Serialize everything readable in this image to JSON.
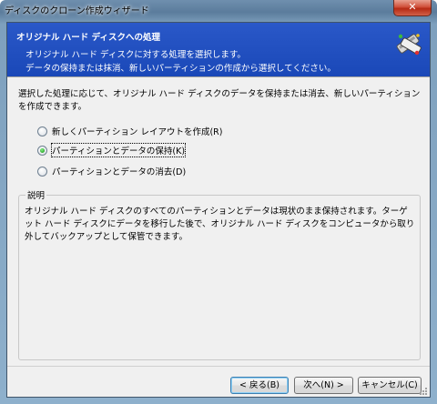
{
  "window": {
    "title": "ディスクのクローン作成ウィザード",
    "close_glyph": "✕"
  },
  "header": {
    "title": "オリジナル ハード ディスクへの処理",
    "desc_line1": "オリジナル ハード ディスクに対する処理を選択します。",
    "desc_line2": "データの保持または抹消、新しいパーティションの作成から選択してください。",
    "icon": "disk-clone-icon"
  },
  "intro_text": "選択した処理に応じて、オリジナル ハード ディスクのデータを保持または消去、新しいパーティションを作成できます。",
  "options": [
    {
      "label": "新しくパーティション レイアウトを作成(R)",
      "checked": false
    },
    {
      "label": "パーティションとデータの保持(K)",
      "checked": true
    },
    {
      "label": "パーティションとデータの消去(D)",
      "checked": false
    }
  ],
  "description_group": {
    "title": "説明",
    "text": "オリジナル ハード ディスクのすべてのパーティションとデータは現状のまま保持されます。ターゲット ハード ディスクにデータを移行した後で、オリジナル ハード ディスクをコンピュータから取り外してバックアップとして保管できます。"
  },
  "buttons": {
    "back": "< 戻る(B)",
    "next": "次へ(N) >",
    "cancel": "キャンセル(C)"
  },
  "colors": {
    "header_bg": "#1a48b8",
    "frame": "#7ea0bd",
    "close_red": "#c8402a",
    "radio_checked": "#1b9e1b"
  }
}
